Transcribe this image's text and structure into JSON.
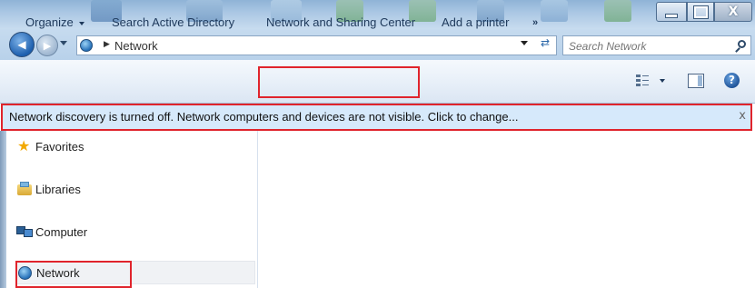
{
  "window": {
    "min_label": "—",
    "max_label": "",
    "close_label": "X"
  },
  "address": {
    "crumb": "Network",
    "separator": "▶"
  },
  "search": {
    "placeholder": "Search Network"
  },
  "toolbar": {
    "organize": "Organize",
    "search_ad": "Search Active Directory",
    "network_sharing": "Network and Sharing Center",
    "add_printer": "Add a printer",
    "more": "»",
    "help": "?"
  },
  "infobar": {
    "message": "Network discovery is turned off. Network computers and devices are not visible. Click to change...",
    "close": "x"
  },
  "nav": {
    "items": [
      {
        "label": "Favorites",
        "icon": "star-icon"
      },
      {
        "label": "Libraries",
        "icon": "libraries-icon"
      },
      {
        "label": "Computer",
        "icon": "computer-icon"
      },
      {
        "label": "Network",
        "icon": "network-icon"
      }
    ]
  },
  "colors": {
    "highlight": "#e0242c",
    "infobar_bg": "#d6e9fb",
    "toolbar_text": "#1e395b"
  }
}
